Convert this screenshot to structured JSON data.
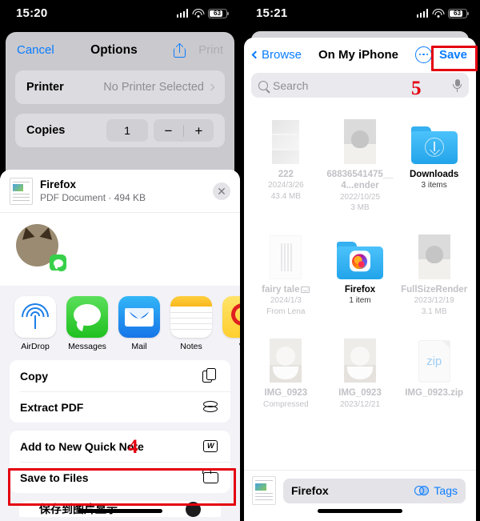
{
  "left_panel": {
    "status_bar": {
      "time": "15:20",
      "battery": "63"
    },
    "print_sheet": {
      "cancel": "Cancel",
      "title": "Options",
      "share_icon": "share-icon",
      "print": "Print",
      "rows": [
        {
          "label": "Printer",
          "value": "No Printer Selected"
        }
      ],
      "copies": {
        "label": "Copies",
        "count": "1",
        "minus": "−",
        "plus": "+"
      }
    },
    "share_sheet": {
      "doc_title": "Firefox",
      "doc_subtitle": "PDF Document · 494 KB",
      "close_icon": "✕",
      "apps": [
        {
          "label": "AirDrop",
          "icon": "airdrop-icon"
        },
        {
          "label": "Messages",
          "icon": "messages-icon"
        },
        {
          "label": "Mail",
          "icon": "mail-icon"
        },
        {
          "label": "Notes",
          "icon": "notes-icon"
        },
        {
          "label": "W",
          "icon": "wechat-icon"
        }
      ],
      "actions_group_1": [
        {
          "label": "Copy",
          "icon": "copy-icon"
        },
        {
          "label": "Extract PDF",
          "icon": "stack-icon"
        }
      ],
      "actions_group_2": [
        {
          "label": "Add to New Quick Note",
          "icon": "quick-note-icon"
        },
        {
          "label": "Save to Files",
          "icon": "folder-icon"
        }
      ],
      "partial_row": "保存到图片显示"
    },
    "annotation": {
      "number": "4"
    }
  },
  "right_panel": {
    "status_bar": {
      "time": "15:21",
      "battery": "63"
    },
    "files": {
      "back": "Browse",
      "title": "On My iPhone",
      "more_icon": "more-circle-icon",
      "save": "Save",
      "search_placeholder": "Search",
      "mic_icon": "microphone-icon",
      "items": [
        {
          "name": "222",
          "meta1": "2024/3/26",
          "meta2": "43.4 MB",
          "kind": "photo",
          "highlight": false
        },
        {
          "name": "68836541475__4...ender",
          "meta1": "2022/10/25",
          "meta2": "3 MB",
          "kind": "cat-photo",
          "highlight": false
        },
        {
          "name": "Downloads",
          "meta1": "3 items",
          "meta2": "",
          "kind": "folder-downloads",
          "highlight": true
        },
        {
          "name": "fairy tale",
          "meta1": "2024/1/3",
          "meta2": "From Lena",
          "kind": "doc",
          "highlight": false,
          "badge": "envelope-icon"
        },
        {
          "name": "Firefox",
          "meta1": "1 item",
          "meta2": "",
          "kind": "folder-firefox",
          "highlight": true
        },
        {
          "name": "FullSizeRender",
          "meta1": "2023/12/19",
          "meta2": "3.1 MB",
          "kind": "cat-photo",
          "highlight": false
        },
        {
          "name": "IMG_0923",
          "meta1": "Compressed",
          "meta2": "",
          "kind": "kitten",
          "highlight": false
        },
        {
          "name": "IMG_0923",
          "meta1": "2023/12/21",
          "meta2": "",
          "kind": "kitten",
          "highlight": false
        },
        {
          "name": "IMG_0923.zip",
          "meta1": "",
          "meta2": "",
          "kind": "zip",
          "highlight": false
        }
      ],
      "bottom": {
        "filename": "Firefox",
        "tags_label": "Tags",
        "tags_icon": "tags-icon"
      }
    },
    "annotation": {
      "number": "5"
    }
  },
  "colors": {
    "accent": "#0a7cff",
    "annotation": "#e4000f",
    "folder": "#4cc2fb"
  }
}
